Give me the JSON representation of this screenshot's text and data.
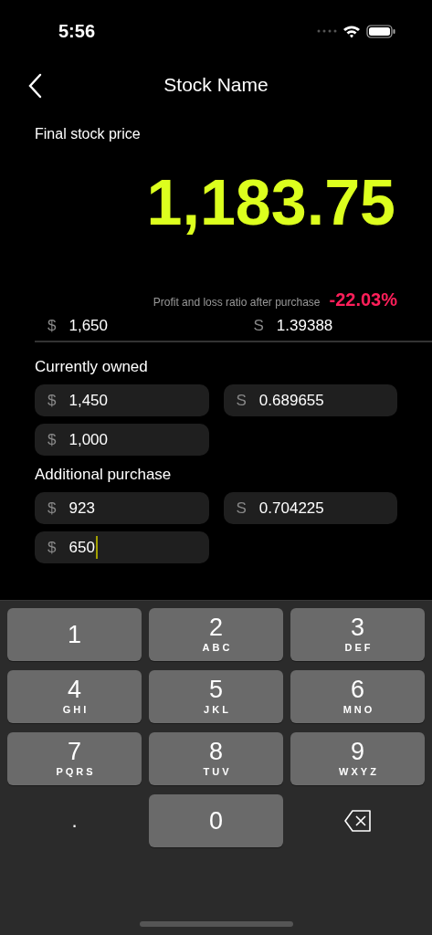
{
  "status_bar": {
    "time": "5:56"
  },
  "nav": {
    "title": "Stock Name"
  },
  "final_price": {
    "label": "Final stock price",
    "value": "1,183.75"
  },
  "ratio": {
    "label": "Profit and loss ratio after purchase",
    "value": "-22.03%"
  },
  "summary": [
    {
      "prefix": "$",
      "value": "1,650"
    },
    {
      "prefix": "S",
      "value": "1.39388"
    }
  ],
  "sections": [
    {
      "title": "Currently owned",
      "fields": [
        {
          "prefix": "$",
          "value": "1,450",
          "focused": false
        },
        {
          "prefix": "S",
          "value": "0.689655",
          "focused": false
        },
        {
          "prefix": "$",
          "value": "1,000",
          "focused": false
        }
      ]
    },
    {
      "title": "Additional purchase",
      "fields": [
        {
          "prefix": "$",
          "value": "923",
          "focused": false
        },
        {
          "prefix": "S",
          "value": "0.704225",
          "focused": false
        },
        {
          "prefix": "$",
          "value": "650",
          "focused": true
        }
      ]
    }
  ],
  "keyboard": [
    {
      "kind": "digit",
      "digit": "1"
    },
    {
      "kind": "digit",
      "digit": "2",
      "letters": "ABC"
    },
    {
      "kind": "digit",
      "digit": "3",
      "letters": "DEF"
    },
    {
      "kind": "digit",
      "digit": "4",
      "letters": "GHI"
    },
    {
      "kind": "digit",
      "digit": "5",
      "letters": "JKL"
    },
    {
      "kind": "digit",
      "digit": "6",
      "letters": "MNO"
    },
    {
      "kind": "digit",
      "digit": "7",
      "letters": "PQRS"
    },
    {
      "kind": "digit",
      "digit": "8",
      "letters": "TUV"
    },
    {
      "kind": "digit",
      "digit": "9",
      "letters": "WXYZ"
    },
    {
      "kind": "plain",
      "digit": "."
    },
    {
      "kind": "digit",
      "digit": "0"
    },
    {
      "kind": "delete"
    }
  ]
}
